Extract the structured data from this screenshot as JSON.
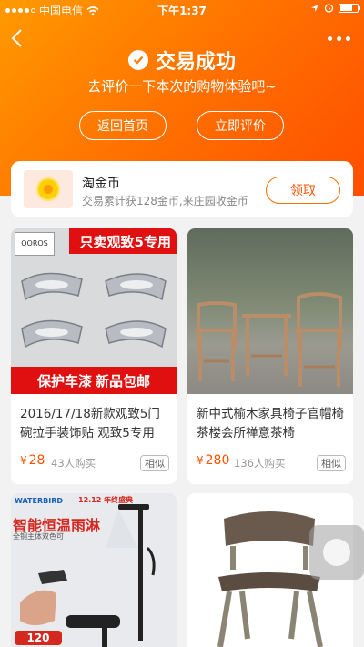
{
  "status_bar": {
    "carrier": "中国电信",
    "time": "下午1:37",
    "signal_bars": 4
  },
  "header": {
    "title": "交易成功",
    "subtitle": "去评价一下本次的购物体验吧~",
    "home_button": "返回首页",
    "review_button": "立即评价"
  },
  "coin_card": {
    "title": "淘金币",
    "description": "交易累计获128金币,来庄园收金币",
    "claim_button": "领取"
  },
  "products": [
    {
      "name": "2016/17/18新款观致5门碗拉手装饰贴 观致5专用",
      "price": "28",
      "sold": "43人购买",
      "similar": "相似",
      "brand": "QOROS",
      "banner_top": "只卖观致5专用",
      "banner_bottom": [
        "保护车漆",
        "新品包邮"
      ]
    },
    {
      "name": "新中式榆木家具椅子官帽椅茶楼会所禅意茶椅",
      "price": "280",
      "sold": "136人购买",
      "similar": "相似"
    },
    {
      "brand": "WATERBIRD",
      "promo_tag": "12.12 年终盛典",
      "headline": "智能恒温雨淋",
      "subline": "全铜主体双色可",
      "price_partial": "120"
    },
    {
      "name": ""
    }
  ],
  "colors": {
    "accent": "#ff5000",
    "header_gradient": [
      "#ff9a00",
      "#ff4e00"
    ],
    "banner_red": "#e01010"
  },
  "currency_symbol": "¥",
  "icons": [
    "back-arrow-icon",
    "more-dots-icon",
    "check-circle-icon",
    "wifi-icon",
    "battery-icon",
    "location-icon",
    "alarm-icon",
    "gold-coin-icon"
  ]
}
